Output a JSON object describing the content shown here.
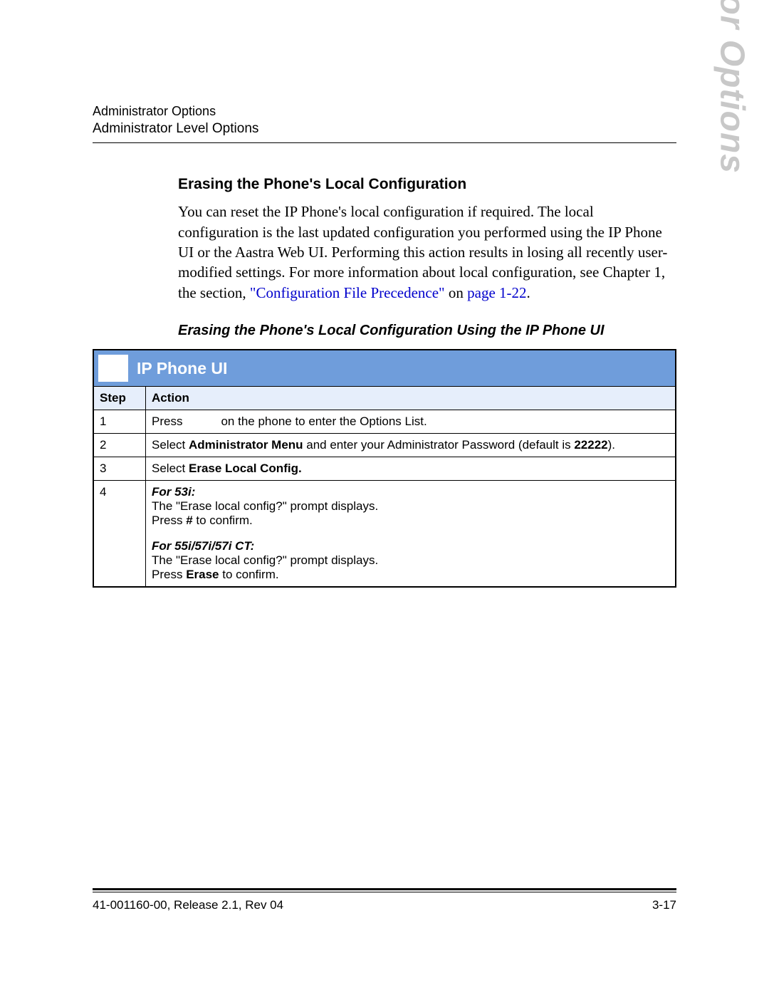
{
  "header": {
    "line1": "Administrator Options",
    "line2": "Administrator Level Options"
  },
  "side_title": "Administrator Options",
  "section": {
    "heading": "Erasing the Phone's Local Configuration",
    "body_pre_link": "You can reset the IP Phone's local configuration if required. The local configuration is the last updated configuration you performed using the IP Phone UI or the Aastra Web UI. Performing this action results in losing all recently user-modified settings. For more information about local configuration, see Chapter 1, the section, ",
    "link_text": "\"Configuration File Precedence\"",
    "body_on": " on ",
    "page_ref": "page 1-22",
    "body_post_link": "."
  },
  "subheading": "Erasing the Phone's Local Configuration Using the IP Phone UI",
  "procedure": {
    "title": "IP Phone UI",
    "col_step": "Step",
    "col_action": "Action",
    "rows": [
      {
        "num": "1",
        "pre": "Press",
        "post": "on the phone to enter the Options List."
      },
      {
        "num": "2",
        "t1": "Select ",
        "b1": "Administrator Menu",
        "t2": " and enter your Administrator Password (default is ",
        "b2": "22222",
        "t3": ")."
      },
      {
        "num": "3",
        "t1": "Select ",
        "b1": "Erase Local Config."
      },
      {
        "num": "4",
        "h1": "For 53i:",
        "l1": "The \"Erase local config?\" prompt displays.",
        "l2a": "Press ",
        "l2b": "#",
        "l2c": " to confirm.",
        "h2": "For 55i/57i/57i CT:",
        "l3": "The \"Erase local config?\" prompt displays.",
        "l4a": "Press ",
        "l4b": "Erase",
        "l4c": " to confirm."
      }
    ]
  },
  "footer": {
    "left": "41-001160-00, Release 2.1, Rev 04",
    "right": "3-17"
  }
}
